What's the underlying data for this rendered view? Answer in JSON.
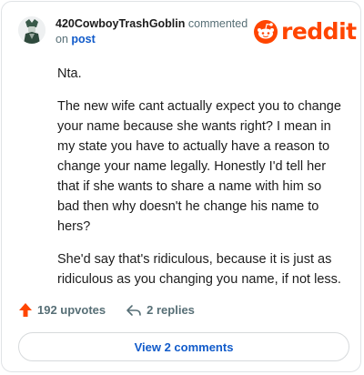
{
  "comment": {
    "username": "420CowboyTrashGoblin",
    "action_text": "commented",
    "on_text": "on",
    "post_link": "post",
    "brand": "reddit",
    "paragraphs": [
      "Nta.",
      "The new wife cant actually expect you to change your name because she wants right? I mean in my state you have to actually have a reason to change your name legally. Honestly I'd tell her that if she wants to share a name with him so bad then why doesn't he change his name to hers?",
      "She'd say that's ridiculous, because it is just as ridiculous as you changing you name, if not less."
    ],
    "upvotes": "192 upvotes",
    "replies": "2 replies",
    "view_button": "View 2 comments"
  },
  "colors": {
    "brand": "#ff4500",
    "link": "#115bca",
    "upvote": "#ff4500"
  },
  "icons": {
    "avatar": "avatar",
    "logo": "reddit-snoo-icon",
    "upvote": "upvote-arrow-icon",
    "reply": "reply-arrow-icon"
  }
}
